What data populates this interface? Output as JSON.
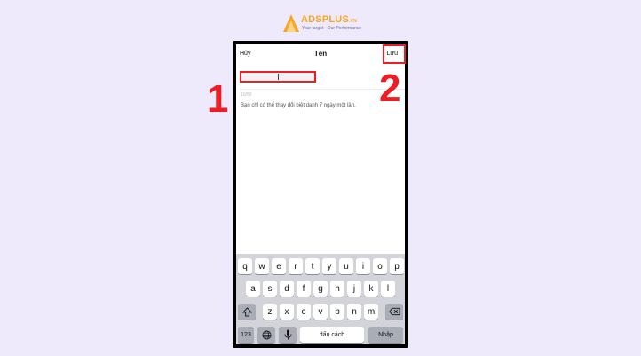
{
  "brand": {
    "name": "ADSPLUS",
    "suffix": ".VN",
    "tagline": "Your target · Our Performance",
    "accent": "#f5a623"
  },
  "navbar": {
    "cancel_label": "Hủy",
    "title": "Tên",
    "save_label": "Lưu"
  },
  "field": {
    "value": "",
    "counter": "10/50"
  },
  "hint": "Bạn chỉ có thể thay đổi biệt danh 7 ngày một lần.",
  "annotations": {
    "marker_1": "1",
    "marker_2": "2",
    "color": "#ee1c25"
  },
  "keyboard": {
    "row1": [
      "q",
      "w",
      "e",
      "r",
      "t",
      "y",
      "u",
      "i",
      "o",
      "p"
    ],
    "row2": [
      "a",
      "s",
      "d",
      "f",
      "g",
      "h",
      "j",
      "k",
      "l"
    ],
    "row3": [
      "z",
      "x",
      "c",
      "v",
      "b",
      "n",
      "m"
    ],
    "shift_icon": "shift-icon",
    "delete_icon": "delete-icon",
    "numbers_label": "123",
    "globe_icon": "globe-icon",
    "mic_icon": "microphone-icon",
    "space_label": "dấu cách",
    "return_label": "Nhập"
  }
}
